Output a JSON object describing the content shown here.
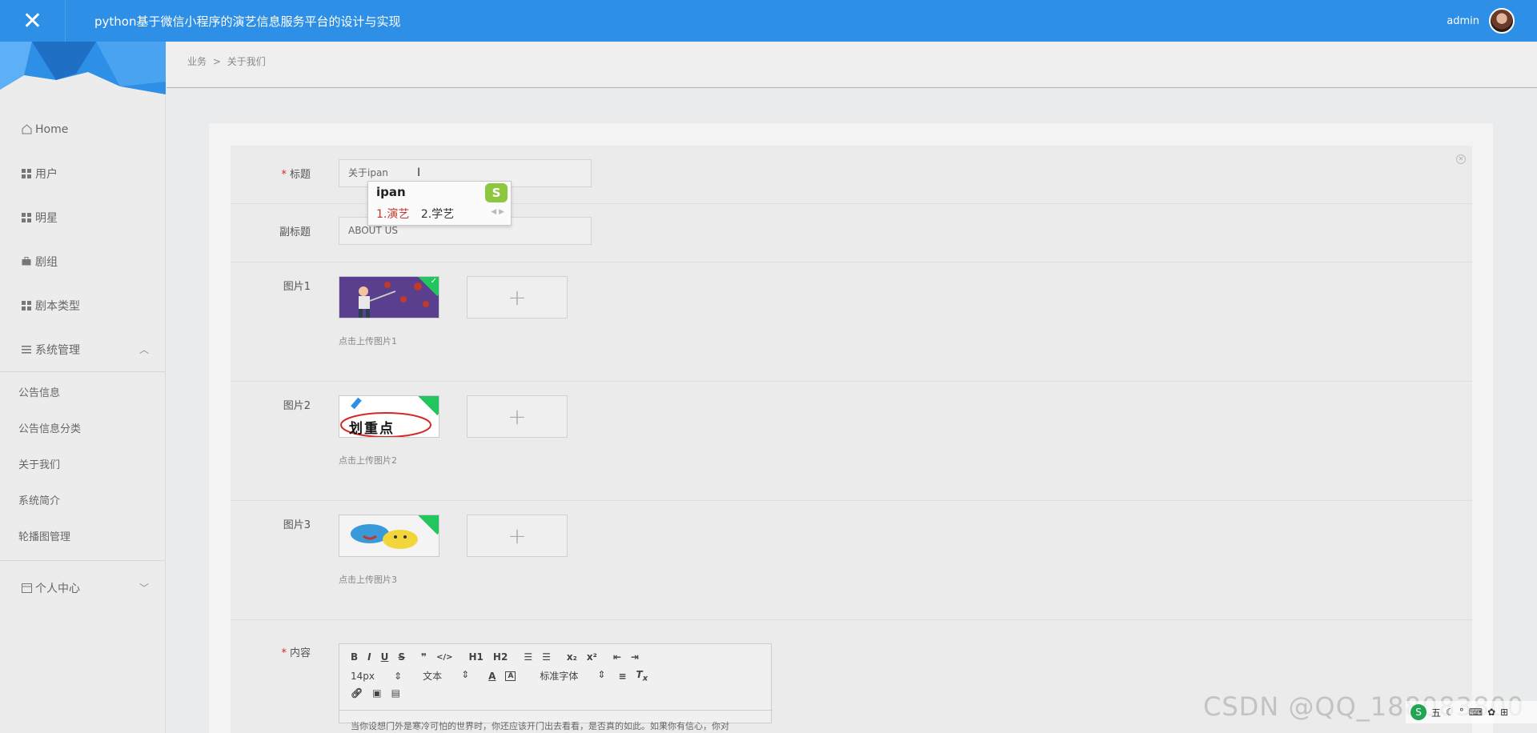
{
  "header": {
    "title": "python基于微信小程序的演艺信息服务平台的设计与实现",
    "username": "admin"
  },
  "sidebar": {
    "items": [
      {
        "label": "Home",
        "icon": "home-icon"
      },
      {
        "label": "用户",
        "icon": "grid-icon"
      },
      {
        "label": "明星",
        "icon": "grid-icon"
      },
      {
        "label": "剧组",
        "icon": "briefcase-icon"
      },
      {
        "label": "剧本类型",
        "icon": "grid-icon"
      },
      {
        "label": "系统管理",
        "icon": "menu-icon"
      }
    ],
    "submenu": [
      "公告信息",
      "公告信息分类",
      "关于我们",
      "系统简介",
      "轮播图管理"
    ],
    "personal": "个人中心"
  },
  "breadcrumb": {
    "parent": "业务",
    "separator": ">",
    "current": "关于我们"
  },
  "form": {
    "title_label": "标题",
    "title_value": "关于ipan",
    "subtitle_label": "副标题",
    "subtitle_value": "ABOUT US",
    "image1_label": "图片1",
    "image1_hint": "点击上传图片1",
    "image2_label": "图片2",
    "image2_hint": "点击上传图片2",
    "image2_text": "划重点",
    "image3_label": "图片3",
    "image3_hint": "点击上传图片3",
    "content_label": "内容",
    "upload_plus": "+",
    "content_text": "当你设想门外是寒冷可怕的世界时，你还应该开门出去看看，是否真的如此。如果你有信心，你对"
  },
  "editor": {
    "font_size": "14px",
    "block_type": "文本",
    "font_family": "标准字体",
    "buttons_row1": [
      "B",
      "I",
      "U",
      "S",
      "❞",
      "</>",
      "H1",
      "H2",
      "☰",
      "☰",
      "x₂",
      "x²",
      "⇤",
      "⇥"
    ]
  },
  "ime": {
    "input": "ipan",
    "candidate1": "1.演艺",
    "candidate2": "2.学艺",
    "logo": "S"
  },
  "watermark": "CSDN @QQ_188083800",
  "tray": {
    "label": "五"
  },
  "colors": {
    "header": "#2d8fe6",
    "required": "#e02424",
    "badge": "#23c55e"
  }
}
